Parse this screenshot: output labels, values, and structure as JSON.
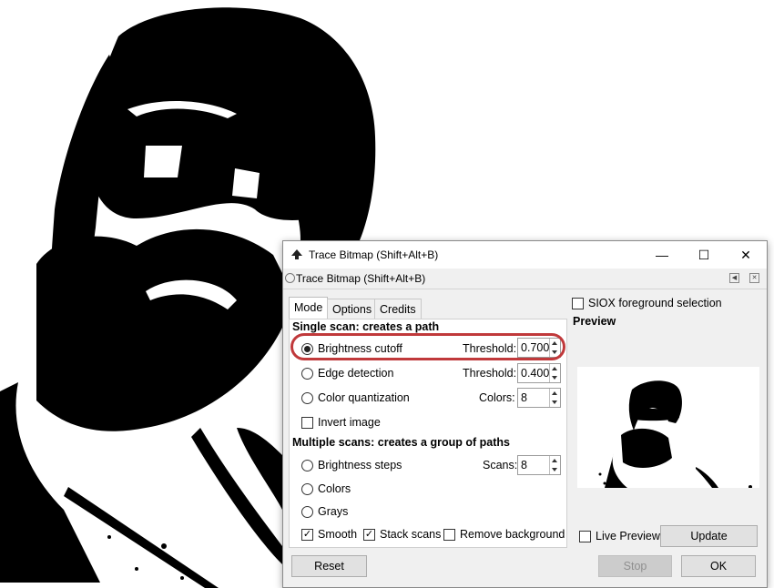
{
  "window": {
    "title": "Trace Bitmap (Shift+Alt+B)",
    "controls": {
      "minimize": "—",
      "maximize": "☐",
      "close": "✕"
    }
  },
  "dock": {
    "title": "Trace Bitmap (Shift+Alt+B)"
  },
  "tabs": [
    {
      "label": "Mode",
      "active": true
    },
    {
      "label": "Options",
      "active": false
    },
    {
      "label": "Credits",
      "active": false
    }
  ],
  "single_scan": {
    "heading": "Single scan: creates a path",
    "options": [
      {
        "label": "Brightness cutoff",
        "selected": true,
        "param_label": "Threshold:",
        "param_value": "0.700"
      },
      {
        "label": "Edge detection",
        "selected": false,
        "param_label": "Threshold:",
        "param_value": "0.400"
      },
      {
        "label": "Color quantization",
        "selected": false,
        "param_label": "Colors:",
        "param_value": "8"
      }
    ],
    "invert_label": "Invert image",
    "invert_checked": false
  },
  "multi_scan": {
    "heading": "Multiple scans: creates a group of paths",
    "options": [
      {
        "label": "Brightness steps",
        "selected": false,
        "param_label": "Scans:",
        "param_value": "8"
      },
      {
        "label": "Colors",
        "selected": false
      },
      {
        "label": "Grays",
        "selected": false
      }
    ],
    "smooth_label": "Smooth",
    "smooth_checked": true,
    "stack_label": "Stack scans",
    "stack_checked": true,
    "remove_bg_label": "Remove background",
    "remove_bg_checked": false
  },
  "right": {
    "siox_label": "SIOX foreground selection",
    "siox_checked": false,
    "preview_heading": "Preview",
    "live_preview_label": "Live Preview",
    "live_preview_checked": false,
    "update_label": "Update"
  },
  "buttons": {
    "reset": "Reset",
    "stop": "Stop",
    "ok": "OK"
  },
  "colors": {
    "highlight": "#c0393b",
    "canvas_fg": "#000000",
    "canvas_bg": "#ffffff"
  }
}
